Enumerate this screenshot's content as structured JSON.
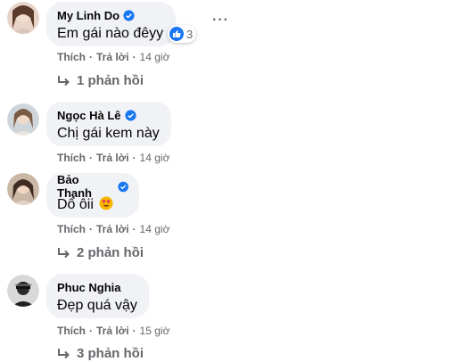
{
  "colors": {
    "accent": "#1877f2",
    "bubble": "#f0f2f5",
    "meta": "#65676b",
    "text": "#050505"
  },
  "comments": [
    {
      "name": "My Linh Do",
      "text": "Em gái nào đêyy",
      "actions": {
        "like": "Thích",
        "reply": "Trả lời",
        "time": "14 giờ"
      },
      "reaction_count": "3",
      "replies": "1 phản hồi"
    },
    {
      "name": "Ngọc Hà Lê",
      "text": "Chị gái kem này",
      "actions": {
        "like": "Thích",
        "reply": "Trả lời",
        "time": "14 giờ"
      },
      "replies": ""
    },
    {
      "name": "Bảo Thanh",
      "text": "Dổ ôii",
      "emoji": "😍",
      "actions": {
        "like": "Thích",
        "reply": "Trả lời",
        "time": "14 giờ"
      },
      "replies": "2 phản hồi"
    },
    {
      "name": "Phuc Nghia",
      "text": "Đẹp quá vậy",
      "actions": {
        "like": "Thích",
        "reply": "Trả lời",
        "time": "15 giờ"
      },
      "replies": "3 phản hồi"
    }
  ],
  "icons": {
    "verified": "verified-badge-icon",
    "reply": "reply-arrow-icon",
    "more": "more-options-icon",
    "like": "like-reaction-icon"
  }
}
